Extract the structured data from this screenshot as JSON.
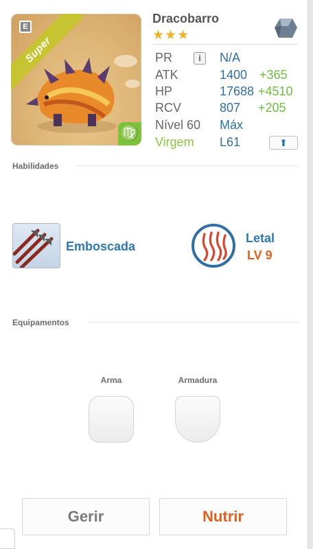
{
  "monster": {
    "name": "Dracobarro",
    "stars": "★★★",
    "rarity_ribbon": "Super",
    "element_badge": "E",
    "zodiac_glyph": "♍"
  },
  "stats": [
    {
      "label": "PR",
      "value": "N/A",
      "bonus": ""
    },
    {
      "label": "ATK",
      "value": "1400",
      "bonus": "+365"
    },
    {
      "label": "HP",
      "value": "17688",
      "bonus": "+4510"
    },
    {
      "label": "RCV",
      "value": "807",
      "bonus": "+205"
    },
    {
      "label": "Nível 60",
      "value": "Máx",
      "bonus": ""
    },
    {
      "label": "Virgem",
      "value": "L61",
      "bonus": ""
    }
  ],
  "abilities": {
    "header": "Habilidades",
    "active_skill": "Emboscada",
    "leader_skill": "Letal",
    "leader_level": "LV 9"
  },
  "equipment": {
    "header": "Equipamentos",
    "weapon_label": "Arma",
    "armor_label": "Armadura"
  },
  "buttons": {
    "manage": "Gerir",
    "feed": "Nutrir"
  },
  "colors": {
    "value_blue": "#2d6fa8",
    "bonus_green": "#6cbf3a",
    "sign_green": "#8cc63f",
    "accent_orange": "#e0601e",
    "star_gold": "#f0b32a"
  }
}
